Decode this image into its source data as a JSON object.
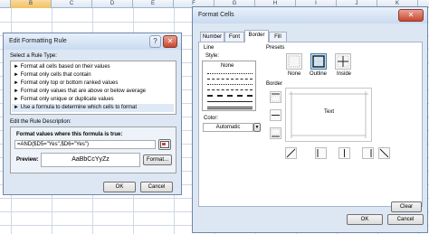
{
  "spreadsheet": {
    "columns": [
      "B",
      "C",
      "D",
      "E",
      "F",
      "G",
      "H",
      "I",
      "J",
      "K",
      "L"
    ]
  },
  "edit_rule": {
    "title": "Edit Formatting Rule",
    "select_type_label": "Select a Rule Type:",
    "rule_types": [
      "► Format all cells based on their values",
      "► Format only cells that contain",
      "► Format only top or bottom ranked values",
      "► Format only values that are above or below average",
      "► Format only unique or duplicate values",
      "► Use a formula to determine which cells to format"
    ],
    "selected_rule_index": 5,
    "description_label": "Edit the Rule Description:",
    "formula_label": "Format values where this formula is true:",
    "formula_value": "=AND($D5=\"Yes\",$D6=\"Yes\")",
    "preview_label": "Preview:",
    "preview_sample": "AaBbCcYyZz",
    "format_button": "Format...",
    "ok_button": "OK",
    "cancel_button": "Cancel"
  },
  "format_cells": {
    "title": "Format Cells",
    "tabs": [
      "Number",
      "Font",
      "Border",
      "Fill"
    ],
    "active_tab": "Border",
    "line_group_label": "Line",
    "style_label": "Style:",
    "style_none": "None",
    "color_label": "Color:",
    "color_value": "Automatic",
    "presets_label": "Presets",
    "preset_labels": [
      "None",
      "Outline",
      "Inside"
    ],
    "border_label": "Border",
    "border_preview_text": "Text",
    "clear_button": "Clear",
    "ok_button": "OK",
    "cancel_button": "Cancel"
  },
  "colors": {
    "accent": "#3c7fb1",
    "close_button": "#c9452f",
    "dialog_bg": "#dde7f3",
    "selected_column": "#f1c15f"
  }
}
